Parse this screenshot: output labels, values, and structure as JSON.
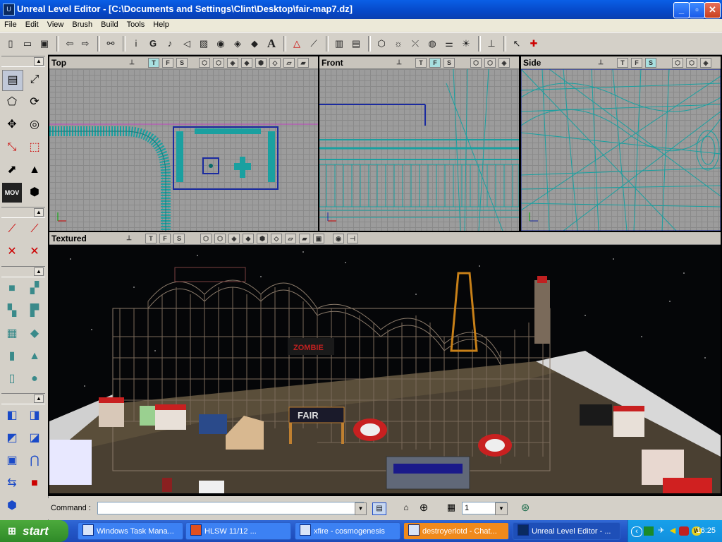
{
  "window": {
    "title": "Unreal Level Editor - [C:\\Documents and Settings\\Clint\\Desktop\\fair-map7.dz]",
    "icon": "unreal-app-icon",
    "controls": {
      "minimize": "_",
      "maximize": "▫",
      "close": "✕"
    }
  },
  "menu": [
    "File",
    "Edit",
    "View",
    "Brush",
    "Build",
    "Tools",
    "Help"
  ],
  "toolbar_icons": [
    "new-file-icon",
    "open-file-icon",
    "save-icon",
    "undo-icon",
    "redo-icon",
    "find-icon",
    "info-icon",
    "group-icon",
    "music-icon",
    "sound-icon",
    "texture-icon",
    "eye-icon",
    "mesh-icon",
    "actor-icon",
    "font-icon",
    "build-geometry-icon",
    "build-lighting-icon",
    "play-level-icon",
    "build-all-icon",
    "light-icon",
    "path-icon",
    "camera-icon",
    "options-icon",
    "bulb-icon",
    "pin-icon",
    "help-icon",
    "context-help-icon"
  ],
  "toolbar_glyphs": {
    "g": "G",
    "a": "A"
  },
  "left_palette": {
    "mov_label": "MOV"
  },
  "viewports": {
    "top": {
      "name": "Top",
      "t": "T",
      "f": "F",
      "s": "S"
    },
    "front": {
      "name": "Front",
      "t": "T",
      "f": "F",
      "s": "S"
    },
    "side": {
      "name": "Side",
      "t": "T",
      "f": "F",
      "s": "S"
    },
    "textured": {
      "name": "Textured",
      "t": "T",
      "f": "F",
      "s": "S"
    }
  },
  "scene_signs": {
    "fair": "FAIR",
    "zombie": "ZOMBIE"
  },
  "command": {
    "label": "Command :",
    "value": "",
    "grid_value": "1"
  },
  "taskbar": {
    "start": "start",
    "tasks": [
      {
        "label": "Windows Task Mana...",
        "state": "normal"
      },
      {
        "label": "HLSW   11/12        ...",
        "state": "normal"
      },
      {
        "label": "xfire - cosmogenesis",
        "state": "normal"
      },
      {
        "label": "destroyerlotd - Chat...",
        "state": "flash"
      },
      {
        "label": "Unreal Level Editor - ...",
        "state": "active"
      }
    ],
    "clock": "16:25"
  },
  "colors": {
    "title_blue": "#0a5fe6",
    "wire_cyan": "#1aa0a0",
    "grid_gray": "#9c9c9c",
    "start_green": "#3c9a32"
  }
}
